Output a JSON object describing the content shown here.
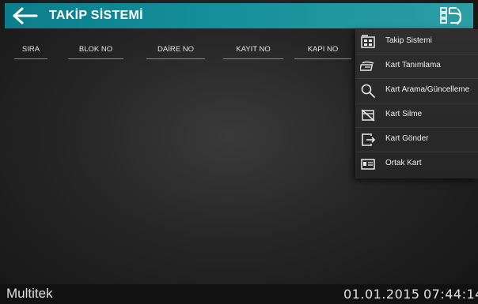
{
  "header": {
    "title": "TAKİP SİSTEMİ",
    "back_icon": "arrow-left-icon",
    "menu_icon": "brand-logo-menu-icon",
    "background_color": "#148f9b"
  },
  "table": {
    "columns": [
      "SIRA",
      "BLOK NO",
      "DAİRE NO",
      "KAYIT NO",
      "KAPI NO"
    ]
  },
  "menu": {
    "items": [
      {
        "label": "Takip Sistemi",
        "icon": "building-list-icon"
      },
      {
        "label": "Kart Tanımlama",
        "icon": "card-define-icon"
      },
      {
        "label": "Kart Arama/Güncelleme",
        "icon": "search-icon"
      },
      {
        "label": "Kart Silme",
        "icon": "card-delete-icon"
      },
      {
        "label": "Kart Gönder",
        "icon": "card-send-icon"
      },
      {
        "label": "Ortak Kart",
        "icon": "id-card-icon"
      }
    ]
  },
  "status": {
    "brand": "Multitek",
    "date": "01.01.2015",
    "time": "07:44:14"
  }
}
